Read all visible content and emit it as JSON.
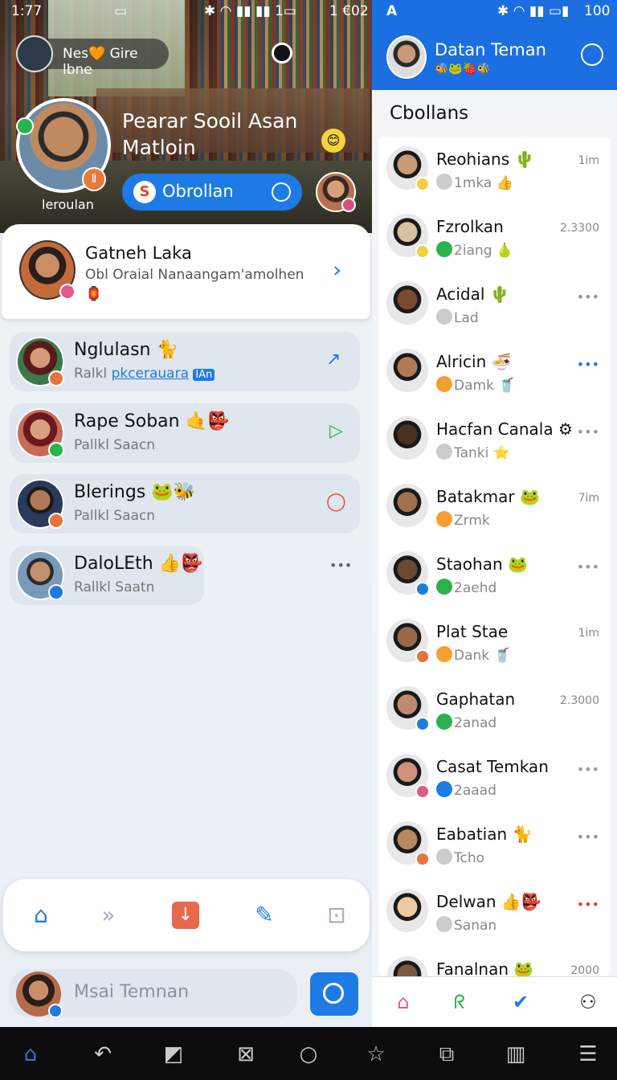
{
  "left_status": {
    "time": "1:77",
    "right": "1 €02"
  },
  "right_status": {
    "left": "A",
    "battery": "100"
  },
  "hero": {
    "pill_text": "Nes🧡 Gire lbne",
    "title_line1": "Pearar Sooil Asan",
    "title_line2": "Matloin",
    "profile_label": "leroulan",
    "button_label": "Obrollan"
  },
  "card": {
    "name": "Gatneh Laka",
    "sub": "Obl Oraial Nanaangam'amolhen",
    "emoji": "🏮"
  },
  "rows": [
    {
      "name": "Nglulasn 🐈",
      "sub": "Ralkl",
      "link": "pkcerauara",
      "tag": "IAn",
      "action": "↗"
    },
    {
      "name": "Rape Soban 🤙👺",
      "sub": "Pallkl Saacn",
      "action": "▷"
    },
    {
      "name": "Blerings 🐸🐝",
      "sub": "Pallkl Saacn",
      "action": "◯"
    },
    {
      "name": "DaloLEth 👍👺",
      "sub": "Rallkl Saatn",
      "action": "•••"
    }
  ],
  "search": {
    "placeholder": "Msai Temnan"
  },
  "right_header": {
    "title": "Datan Teman",
    "emoji": "🐝🐸🍓🐝"
  },
  "right_section": "Cbollans",
  "contacts": [
    {
      "name": "Reohians 🌵",
      "sub": "1mka 👍",
      "time": "1im"
    },
    {
      "name": "Fzrolkan",
      "sub": "2iang 🍐",
      "time": "2.3300"
    },
    {
      "name": "Acidal 🌵",
      "sub": "Lad",
      "time": "•••"
    },
    {
      "name": "Alricin 🍜",
      "sub": "Damk 🥤",
      "time": "•••"
    },
    {
      "name": "Hacfan Canala ⚙",
      "sub": "Tanki ⭐",
      "time": "•••"
    },
    {
      "name": "Batakmar 🐸",
      "sub": "Zrmk",
      "time": "7im"
    },
    {
      "name": "Staohan 🐸",
      "sub": "2aehd",
      "time": "•••"
    },
    {
      "name": "Plat Stae",
      "sub": "Dank 🥤",
      "time": "1im"
    },
    {
      "name": "Gaphatan",
      "sub": "2anad",
      "time": "2.3000"
    },
    {
      "name": "Casat Temkan",
      "sub": "2aaad",
      "time": "•••"
    },
    {
      "name": "Eabatian 🐈",
      "sub": "Tcho",
      "time": "•••"
    },
    {
      "name": "Delwan 👍👺",
      "sub": "Sanan",
      "time": "•••"
    },
    {
      "name": "Fanalnan 🐸",
      "sub": "",
      "time": "2000"
    }
  ]
}
